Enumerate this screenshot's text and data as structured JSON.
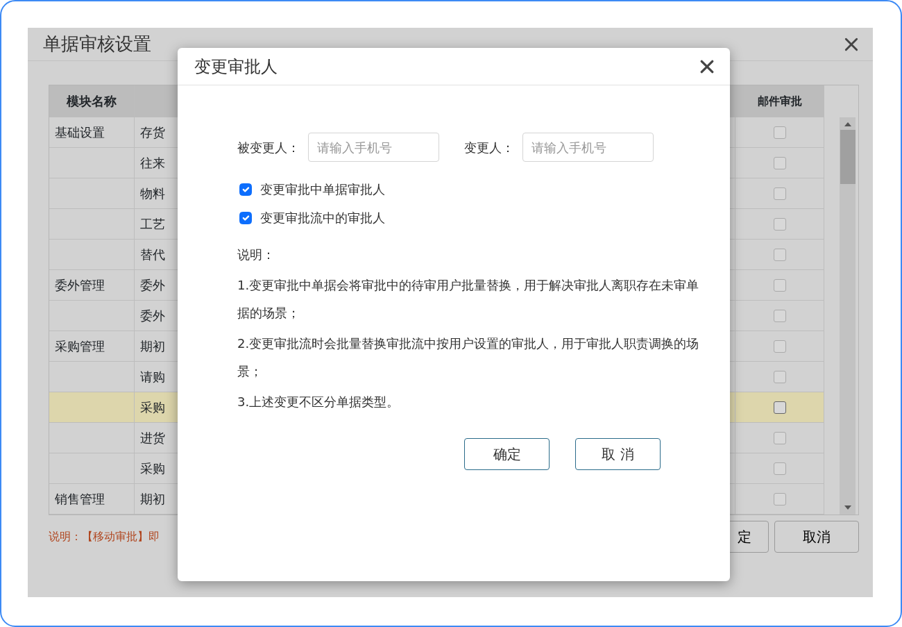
{
  "window": {
    "title": "单据审核设置"
  },
  "table": {
    "columns": [
      "模块名称",
      "邮件审批"
    ],
    "rows": [
      {
        "module": "基础设置",
        "document": "存货",
        "email_approval": false,
        "selected": false
      },
      {
        "module": "",
        "document": "往来",
        "email_approval": false,
        "selected": false
      },
      {
        "module": "",
        "document": "物料",
        "email_approval": false,
        "selected": false
      },
      {
        "module": "",
        "document": "工艺",
        "email_approval": false,
        "selected": false
      },
      {
        "module": "",
        "document": "替代",
        "email_approval": false,
        "selected": false
      },
      {
        "module": "委外管理",
        "document": "委外",
        "email_approval": false,
        "selected": false
      },
      {
        "module": "",
        "document": "委外",
        "email_approval": false,
        "selected": false
      },
      {
        "module": "采购管理",
        "document": "期初",
        "email_approval": false,
        "selected": false
      },
      {
        "module": "",
        "document": "请购",
        "email_approval": false,
        "selected": false
      },
      {
        "module": "",
        "document": "采购",
        "email_approval": false,
        "selected": true
      },
      {
        "module": "",
        "document": "进货",
        "email_approval": false,
        "selected": false
      },
      {
        "module": "",
        "document": "采购",
        "email_approval": false,
        "selected": false
      },
      {
        "module": "销售管理",
        "document": "期初",
        "email_approval": false,
        "selected": false
      }
    ]
  },
  "note": "说明：【移动审批】即",
  "buttons": [
    "定",
    "取消"
  ],
  "dialog": {
    "title": "变更审批人",
    "fields": [
      {
        "label": "被变更人：",
        "placeholder": "请输入手机号"
      },
      {
        "label": "变更人：",
        "placeholder": "请输入手机号"
      }
    ],
    "options": [
      {
        "label": "变更审批中单据审批人",
        "checked": true
      },
      {
        "label": "变更审批流中的审批人",
        "checked": true
      }
    ],
    "description_title": "说明：",
    "description": [
      "1.变更审批中单据会将审批中的待审用户批量替换，用于解决审批人离职存在未审单据的场景；",
      "2.变更审批流时会批量替换审批流中按用户设置的审批人，用于审批人职责调换的场景；",
      "3.上述变更不区分单据类型。"
    ],
    "buttons": [
      "确定",
      "取 消"
    ]
  }
}
